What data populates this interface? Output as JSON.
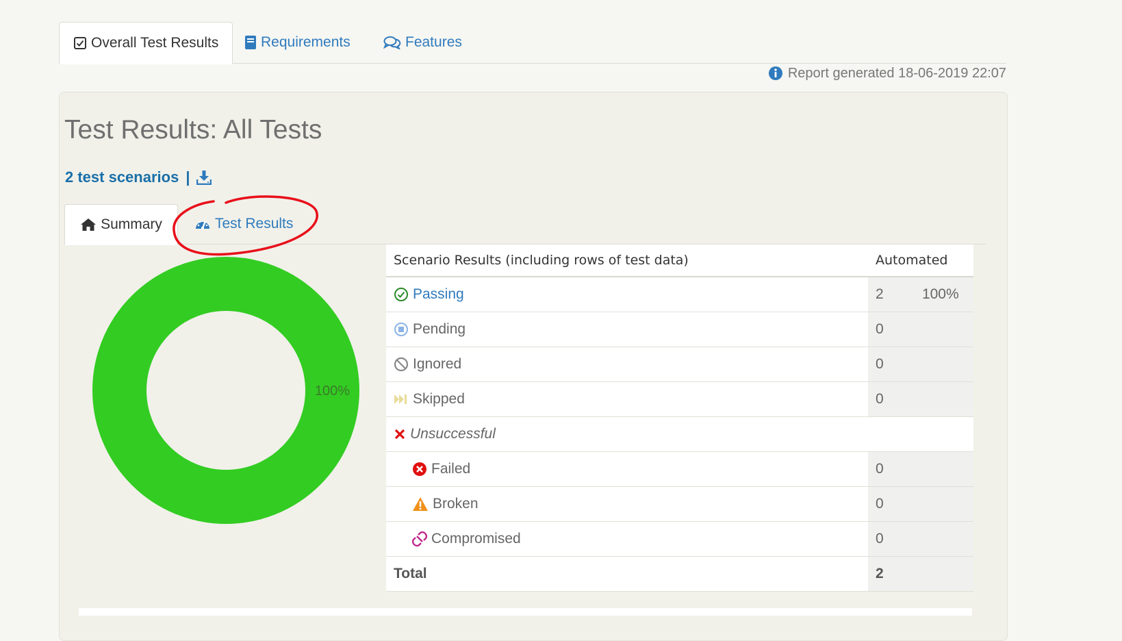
{
  "top_tabs": [
    {
      "label": "Overall Test Results",
      "icon": "check-square-icon",
      "active": true
    },
    {
      "label": "Requirements",
      "icon": "book-icon",
      "active": false
    },
    {
      "label": "Features",
      "icon": "comments-icon",
      "active": false
    }
  ],
  "report_generated": "Report generated 18-06-2019 22:07",
  "page_title": "Test Results: All Tests",
  "scenario_count_link": "2 test scenarios",
  "scenario_sep": "|",
  "sub_tabs": [
    {
      "label": "Summary",
      "icon": "home-icon",
      "active": true
    },
    {
      "label": "Test Results",
      "icon": "dashboard-icon",
      "active": false
    }
  ],
  "chart_data": {
    "type": "pie",
    "donut": true,
    "categories": [
      "Passing"
    ],
    "values": [
      100
    ],
    "value_labels": [
      "100%"
    ],
    "colors": [
      "#33cc22"
    ]
  },
  "results_table": {
    "header": {
      "label": "Scenario Results (including rows of test data)",
      "col": "Automated"
    },
    "rows": [
      {
        "label": "Passing",
        "count": "2",
        "percent": "100%",
        "icon": "check-circle-icon",
        "color": "#2a8a2a"
      },
      {
        "label": "Pending",
        "count": "0",
        "icon": "stop-circle-icon",
        "color": "#8ab4e6"
      },
      {
        "label": "Ignored",
        "count": "0",
        "icon": "ban-icon",
        "color": "#888888"
      },
      {
        "label": "Skipped",
        "count": "0",
        "icon": "fast-forward-icon",
        "color": "#e8dc9a"
      },
      {
        "label": "Unsuccessful",
        "icon": "times-icon",
        "color": "#e01010"
      },
      {
        "label": "Failed",
        "count": "0",
        "icon": "times-circle-icon",
        "color": "#e01010"
      },
      {
        "label": "Broken",
        "count": "0",
        "icon": "warning-icon",
        "color": "#f0901a"
      },
      {
        "label": "Compromised",
        "count": "0",
        "icon": "chain-broken-icon",
        "color": "#c0268c"
      }
    ],
    "total": {
      "label": "Total",
      "count": "2"
    }
  }
}
